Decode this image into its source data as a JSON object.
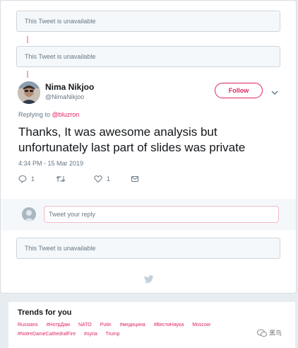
{
  "unavailable_notices": [
    "This Tweet is unavailable",
    "This Tweet is unavailable",
    "This Tweet is unavailable"
  ],
  "tweet": {
    "author_name": "Nima Nikjoo",
    "author_handle": "@NimaNikjoo",
    "follow_label": "Follow",
    "replying_prefix": "Replying to",
    "replying_handle": "@bluzron",
    "text": "Thanks, It was awesome analysis but unfortunately last part of slides was private",
    "timestamp": "4:34 PM - 15 Mar 2019",
    "reply_count": "1",
    "like_count": "1",
    "icons": [
      "reply-icon",
      "retweet-icon",
      "like-icon",
      "direct-message-icon",
      "chevron-down-icon"
    ]
  },
  "reply_box": {
    "placeholder": "Tweet your reply"
  },
  "trends": {
    "title": "Trends for you",
    "row1": [
      "Russians",
      "#НотрДам",
      "NATO",
      "Putin",
      "#медицина",
      "#ВестиНаука",
      "Moscow"
    ],
    "row2": [
      "#NotreDameCathedralFire",
      "#syria",
      "Trump"
    ]
  },
  "watermark": "黑鸟",
  "colors": {
    "accent": "#e0245e",
    "muted": "#657786",
    "background": "#e6ecf0"
  }
}
